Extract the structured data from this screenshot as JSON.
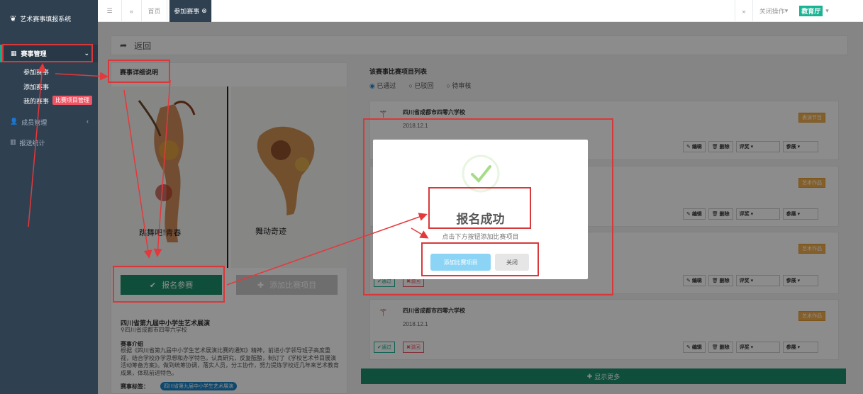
{
  "app": {
    "name": "艺术赛事填报系统"
  },
  "sidebar": {
    "main_item": "赛事管理",
    "sub_items": [
      "参加赛事",
      "添加赛事",
      "我的赛事"
    ],
    "annotation_badge": "比赛项目管理",
    "items": [
      "成员管理",
      "报送统计"
    ]
  },
  "topbar": {
    "home_tab": "首页",
    "active_tab": "参加赛事",
    "close_ops": "关闭操作",
    "user": "教育厅"
  },
  "back": {
    "label": "返回"
  },
  "left": {
    "section_title": "赛事详细说明",
    "poster1_title": "跳舞吧!青春",
    "poster2_title": "舞动奇迹",
    "register_btn": "报名参赛",
    "add_item_btn": "添加比赛项目",
    "event_title": "四川省第九届中小学生艺术展演",
    "location": "四川省成都市四零六学校",
    "intro_label": "赛事介绍",
    "intro_text": "根据《四川省第九届中小学生艺术展演比赛的通知》精神，前进小学领导班子高度重视，结合学校办学思想和办学特色，认真研究，反复酝酿，制订了《学校艺术节目展演活动筹备方案》。做到统筹协调，落实人员，分工协作，努力提炼学校近几年来艺术教育成果，体现前进特色。",
    "tag_label": "赛事标签：",
    "tag_value": "四川省第九届中小学生艺术展演"
  },
  "right": {
    "title": "该赛事比赛项目列表",
    "filters": [
      "已通过",
      "已驳回",
      "待审核"
    ],
    "cards": [
      {
        "school": "四川省成都市四零六学校",
        "date": "2018.12.1",
        "tag": "表演节目"
      },
      {
        "school": "",
        "date": "",
        "tag": "艺术作品"
      },
      {
        "school": "",
        "date": "",
        "tag": "艺术作品"
      },
      {
        "school": "四川省成都市四零六学校",
        "date": "2018.12.1",
        "tag": "艺术作品"
      }
    ],
    "edit": "编辑",
    "delete": "删除",
    "review": "评奖",
    "award": "参展",
    "approve": "通过",
    "reject": "驳回",
    "more": "显示更多"
  },
  "modal": {
    "title": "报名成功",
    "subtitle": "点击下方按钮添加比赛项目",
    "add_btn": "添加比赛项目",
    "close_btn": "关闭"
  },
  "colors": {
    "sidebar": "#2f4050",
    "green": "#1b8f6a",
    "red": "#d9383a",
    "orange": "#f0ad4e"
  }
}
